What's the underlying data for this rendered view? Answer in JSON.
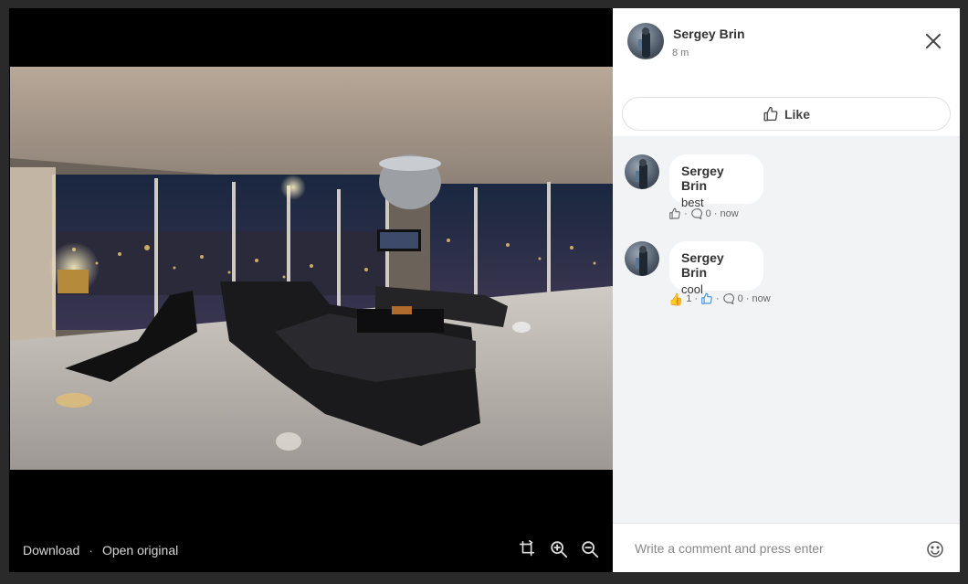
{
  "viewer": {
    "photo_alt": "Living room with black leather sofa and panoramic city night view",
    "download_label": "Download",
    "separator": "·",
    "open_original_label": "Open original",
    "tools": [
      "rotate-icon",
      "zoom-in-icon",
      "zoom-out-icon"
    ]
  },
  "post": {
    "author": "Sergey Brin",
    "time": "8 m",
    "like_label": "Like"
  },
  "comments": [
    {
      "author": "Sergey Brin",
      "text": "best",
      "replies": "0",
      "time": "now"
    },
    {
      "author": "Sergey Brin",
      "text": "cool",
      "reaction_emoji": "👍",
      "reaction_count": "1",
      "replies": "0",
      "time": "now"
    }
  ],
  "composer": {
    "placeholder": "Write a comment and press enter"
  },
  "colors": {
    "like_blue": "#3b8fd9",
    "bubble_bg": "#ffffff",
    "comments_bg": "#f2f3f5"
  }
}
